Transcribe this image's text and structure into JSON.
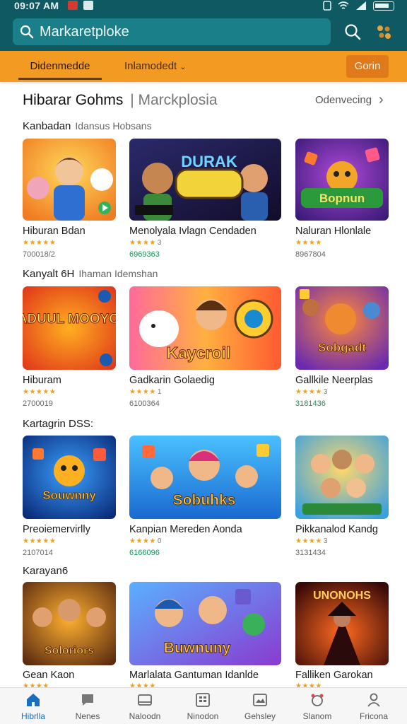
{
  "status": {
    "time": "09:07 AM"
  },
  "search": {
    "text": "Markaretploke"
  },
  "tabs": {
    "active": "Didenmedde",
    "dropdown": "Inlamodedt",
    "button": "Gorin"
  },
  "header": {
    "title": "Hibarar Gohms",
    "subtitle": "Marckplosia",
    "see_all": "Odenvecing"
  },
  "rows": [
    {
      "label": "Kanbadan",
      "sublabel": "Idansus Hobsans",
      "cards": [
        {
          "title": "Hiburan Bdan",
          "stars": "★★★★★",
          "rating": "",
          "meta": "700018/2",
          "meta_green": false,
          "art_text": ""
        },
        {
          "title": "Menolyala Ivlagn Cendaden",
          "stars": "★★★★",
          "rating": "3",
          "meta": "6969363",
          "meta_green": true,
          "art_text": "DURAK"
        },
        {
          "title": "Naluran Hlonlale",
          "stars": "★★★★",
          "rating": "",
          "meta": "8967804",
          "meta_green": false,
          "art_text": "Bopnun"
        }
      ]
    },
    {
      "label": "Kanyalt 6H",
      "sublabel": "Ihaman Idemshan",
      "cards": [
        {
          "title": "Hiburam",
          "stars": "★★★★★",
          "rating": "",
          "meta": "2700019",
          "meta_green": false,
          "art_text": "ZADUUL MOOYON"
        },
        {
          "title": "Gadkarin Golaedig",
          "stars": "★★★★",
          "rating": "1",
          "meta": "6100364",
          "meta_green": false,
          "art_text": "Kaycroil"
        },
        {
          "title": "Gallkile Neerplas",
          "stars": "★★★★",
          "rating": "3",
          "meta": "3181436",
          "meta_green": true,
          "art_text": "Sobgadt"
        }
      ]
    },
    {
      "label": "Kartagrin DSS:",
      "sublabel": "",
      "cards": [
        {
          "title": "Preoiemervirlly",
          "stars": "★★★★★",
          "rating": "",
          "meta": "2107014",
          "meta_green": false,
          "art_text": "Souwnny"
        },
        {
          "title": "Kanpian Mereden Aonda",
          "stars": "★★★★",
          "rating": "0",
          "meta": "6166096",
          "meta_green": true,
          "art_text": "Sobuhks"
        },
        {
          "title": "Pikkanalod Kandg",
          "stars": "★★★★",
          "rating": "3",
          "meta": "3131434",
          "meta_green": false,
          "art_text": ""
        }
      ]
    },
    {
      "label": "Karayan6",
      "sublabel": "",
      "cards": [
        {
          "title": "Gean Kaon",
          "stars": "★★★★",
          "rating": "",
          "meta": "",
          "meta_green": false,
          "art_text": "Soloriors"
        },
        {
          "title": "Marlalata Gantuman Idanlde",
          "stars": "★★★★",
          "rating": "",
          "meta": "",
          "meta_green": false,
          "art_text": "Buwnuny"
        },
        {
          "title": "Falliken Garokan",
          "stars": "★★★★",
          "rating": "",
          "meta": "",
          "meta_green": false,
          "art_text": "UNONOHS"
        }
      ]
    }
  ],
  "nav": [
    {
      "label": "Hibrlla",
      "icon": "home-icon"
    },
    {
      "label": "Nenes",
      "icon": "chat-icon"
    },
    {
      "label": "Naloodn",
      "icon": "library-icon"
    },
    {
      "label": "Ninodon",
      "icon": "grid-icon"
    },
    {
      "label": "Gehsley",
      "icon": "image-icon"
    },
    {
      "label": "Slanom",
      "icon": "pet-icon"
    },
    {
      "label": "Fricona",
      "icon": "profile-icon"
    }
  ],
  "colors": {
    "header": "#0f5a62",
    "search_bg": "#1a7f88",
    "tab_bar": "#f29a22",
    "tab_button": "#e0791a",
    "active_nav": "#1a6ec0",
    "stars": "#f0a020"
  }
}
